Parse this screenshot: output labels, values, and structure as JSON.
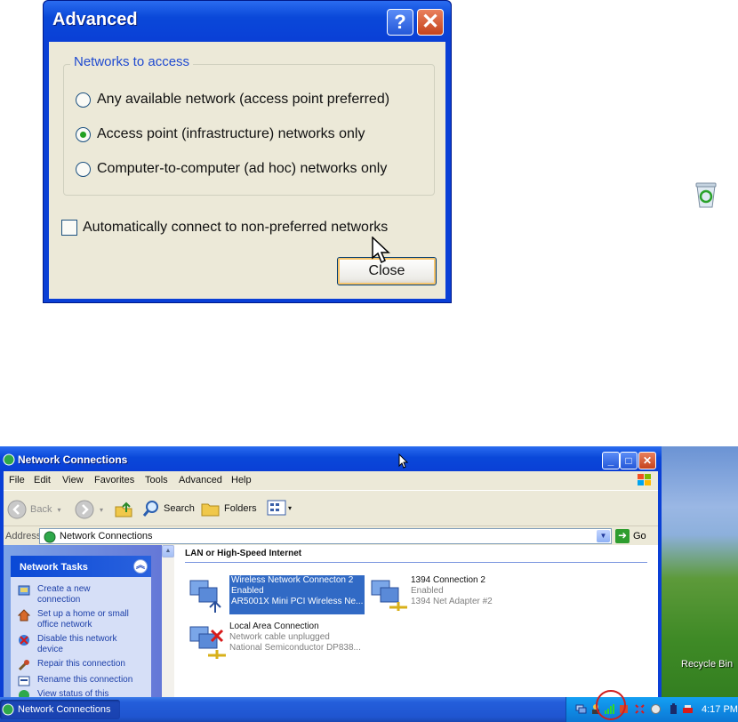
{
  "dialog": {
    "title": "Advanced",
    "help_glyph": "?",
    "close_glyph": "✕",
    "group_label": "Networks to access",
    "options": [
      {
        "label": "Any available network (access point preferred)",
        "selected": false
      },
      {
        "label": "Access point (infrastructure) networks only",
        "selected": true
      },
      {
        "label": "Computer-to-computer (ad hoc) networks only",
        "selected": false
      }
    ],
    "auto_connect_label": "Automatically connect to non-preferred networks",
    "auto_connect_checked": false,
    "close_button": "Close"
  },
  "window": {
    "title": "Network Connections",
    "controls": {
      "minimize": "_",
      "maximize": "□",
      "close": "✕"
    },
    "menu": [
      "File",
      "Edit",
      "View",
      "Favorites",
      "Tools",
      "Advanced",
      "Help"
    ],
    "toolbar": {
      "back": "Back",
      "search": "Search",
      "folders": "Folders",
      "view_dropdown": "▾"
    },
    "address": {
      "label": "Address",
      "value": "Network Connections",
      "go": "Go"
    },
    "network_tasks": {
      "title": "Network Tasks",
      "collapse_glyph": "︽",
      "items": [
        {
          "label": "Create a new connection",
          "icon": "new-connection-icon"
        },
        {
          "label": "Set up a home or small office network",
          "icon": "home-network-icon"
        },
        {
          "label": "Disable this network device",
          "icon": "disable-device-icon"
        },
        {
          "label": "Repair this connection",
          "icon": "repair-icon"
        },
        {
          "label": "Rename this connection",
          "icon": "rename-icon"
        },
        {
          "label": "View status of this",
          "icon": "status-icon"
        }
      ]
    },
    "section_title": "LAN or High-Speed Internet",
    "connections": [
      {
        "name": "Wireless Network Connecton 2",
        "status": "Enabled",
        "device": "AR5001X Mini PCI Wireless Ne...",
        "selected": true,
        "icon": "wireless-connection-icon"
      },
      {
        "name": "1394 Connection 2",
        "status": "Enabled",
        "device": "1394 Net Adapter #2",
        "selected": false,
        "icon": "firewire-connection-icon"
      },
      {
        "name": "Local Area Connection",
        "status": "Network cable unplugged",
        "device": "National Semiconductor DP838...",
        "selected": false,
        "icon": "lan-disconnected-icon"
      }
    ]
  },
  "desktop": {
    "recycle_bin": "Recycle Bin"
  },
  "taskbar": {
    "active_window": "Network Connections",
    "clock": "4:17 PM"
  },
  "colors": {
    "xp_blue": "#0a3fd6",
    "dialog_face": "#ece9d8",
    "selection": "#316ac5",
    "highlight_ring": "#d11f1f"
  }
}
